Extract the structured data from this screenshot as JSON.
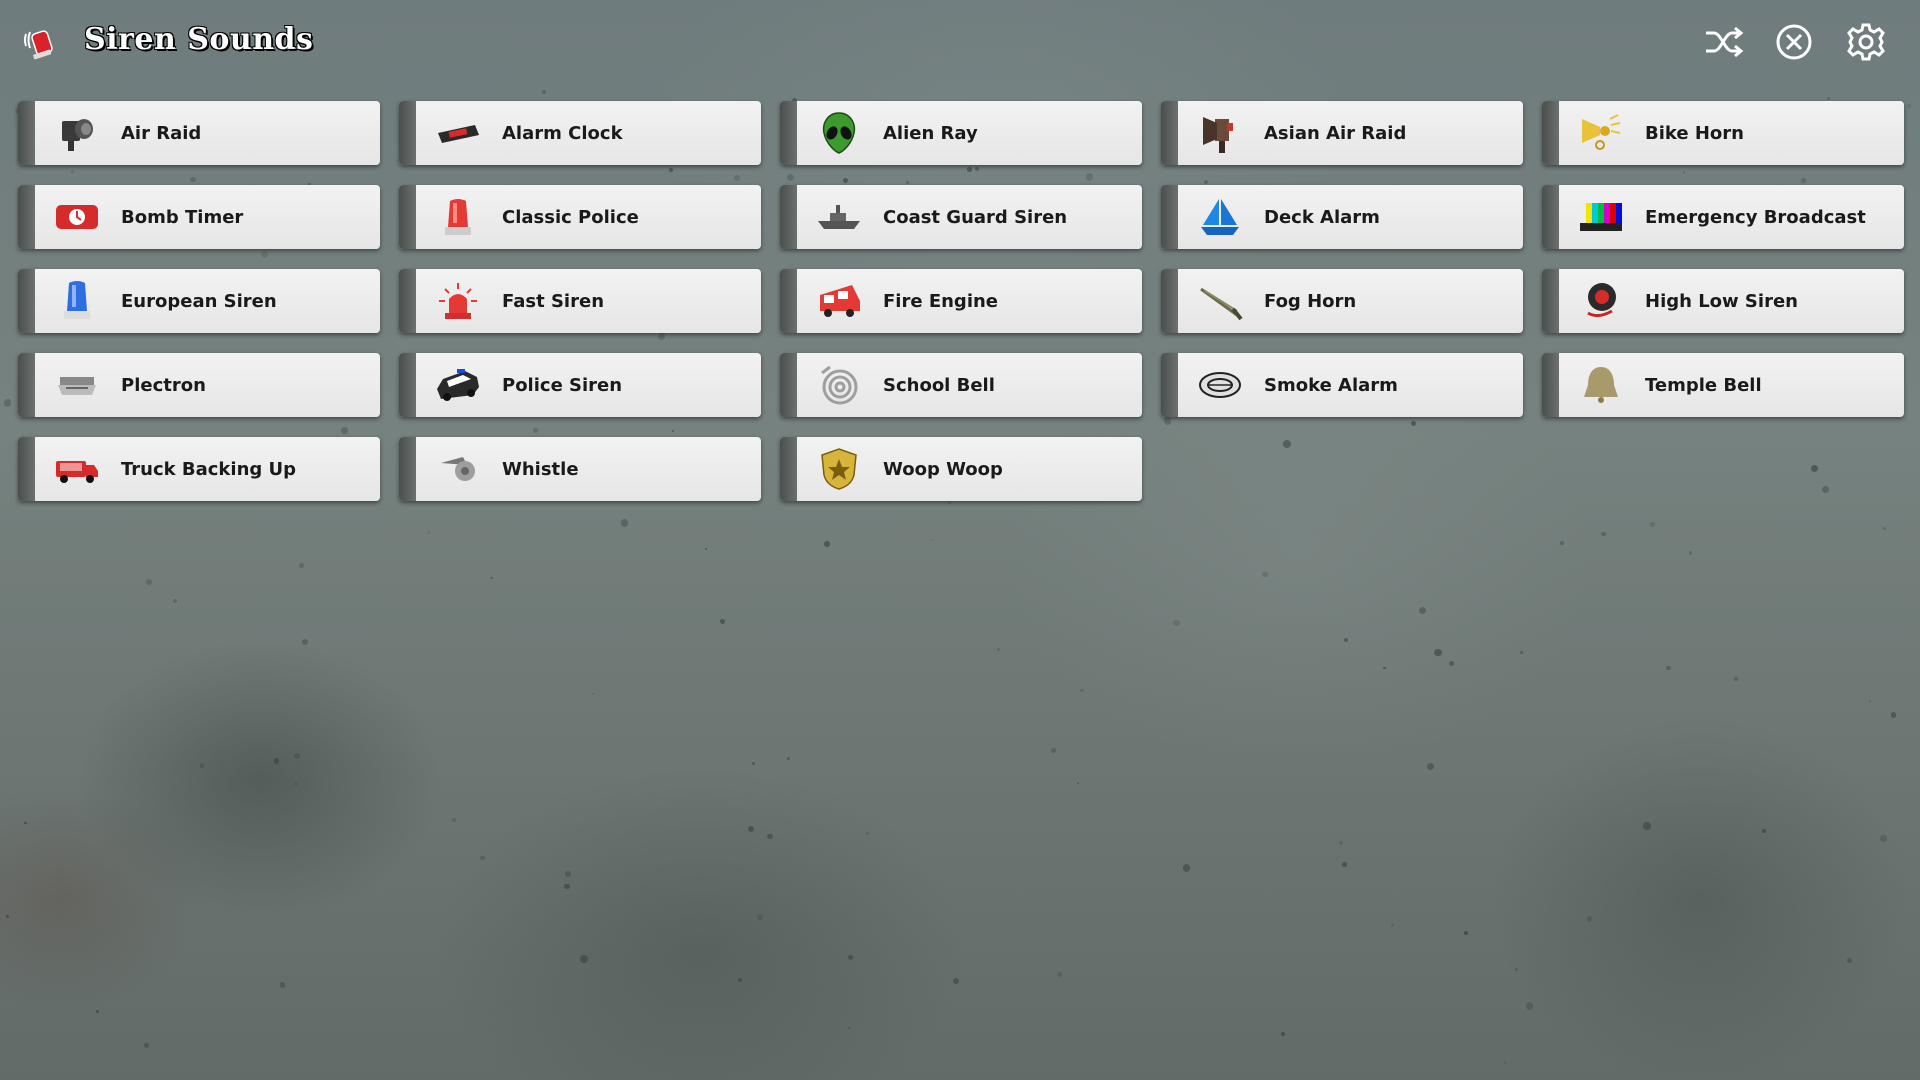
{
  "app": {
    "title": "Siren Sounds",
    "icon": "siren-app-icon"
  },
  "toolbar": [
    {
      "name": "shuffle-button",
      "icon": "shuffle-icon"
    },
    {
      "name": "stop-button",
      "icon": "close-circle-icon"
    },
    {
      "name": "settings-button",
      "icon": "gear-icon"
    }
  ],
  "sounds": [
    {
      "id": "air-raid",
      "label": "Air Raid",
      "icon": "air-raid-siren-icon"
    },
    {
      "id": "alarm-clock",
      "label": "Alarm Clock",
      "icon": "alarm-clock-icon"
    },
    {
      "id": "alien-ray",
      "label": "Alien Ray",
      "icon": "alien-icon"
    },
    {
      "id": "asian-air-raid",
      "label": "Asian Air Raid",
      "icon": "megaphone-siren-icon"
    },
    {
      "id": "bike-horn",
      "label": "Bike Horn",
      "icon": "bike-horn-icon"
    },
    {
      "id": "bomb-timer",
      "label": "Bomb Timer",
      "icon": "bomb-timer-icon"
    },
    {
      "id": "classic-police",
      "label": "Classic Police",
      "icon": "red-beacon-icon"
    },
    {
      "id": "coast-guard-siren",
      "label": "Coast Guard Siren",
      "icon": "ship-icon"
    },
    {
      "id": "deck-alarm",
      "label": "Deck Alarm",
      "icon": "sailboat-icon"
    },
    {
      "id": "emergency-broadcast",
      "label": "Emergency Broadcast",
      "icon": "color-bars-icon"
    },
    {
      "id": "european-siren",
      "label": "European Siren",
      "icon": "blue-beacon-icon"
    },
    {
      "id": "fast-siren",
      "label": "Fast Siren",
      "icon": "flashing-beacon-icon"
    },
    {
      "id": "fire-engine",
      "label": "Fire Engine",
      "icon": "fire-truck-icon"
    },
    {
      "id": "fog-horn",
      "label": "Fog Horn",
      "icon": "fog-horn-icon"
    },
    {
      "id": "high-low-siren",
      "label": "High Low Siren",
      "icon": "speaker-siren-icon"
    },
    {
      "id": "plectron",
      "label": "Plectron",
      "icon": "radio-receiver-icon"
    },
    {
      "id": "police-siren",
      "label": "Police Siren",
      "icon": "police-car-icon"
    },
    {
      "id": "school-bell",
      "label": "School Bell",
      "icon": "school-bell-icon"
    },
    {
      "id": "smoke-alarm",
      "label": "Smoke Alarm",
      "icon": "smoke-detector-icon"
    },
    {
      "id": "temple-bell",
      "label": "Temple Bell",
      "icon": "bell-icon"
    },
    {
      "id": "truck-backing-up",
      "label": "Truck Backing Up",
      "icon": "truck-icon"
    },
    {
      "id": "whistle",
      "label": "Whistle",
      "icon": "whistle-icon"
    },
    {
      "id": "woop-woop",
      "label": "Woop Woop",
      "icon": "police-badge-icon"
    }
  ],
  "colors": {
    "title_text": "#ffffff",
    "tile_bg": "#ececec",
    "tile_edge": "#555958",
    "label_text": "#1a1a1a"
  }
}
